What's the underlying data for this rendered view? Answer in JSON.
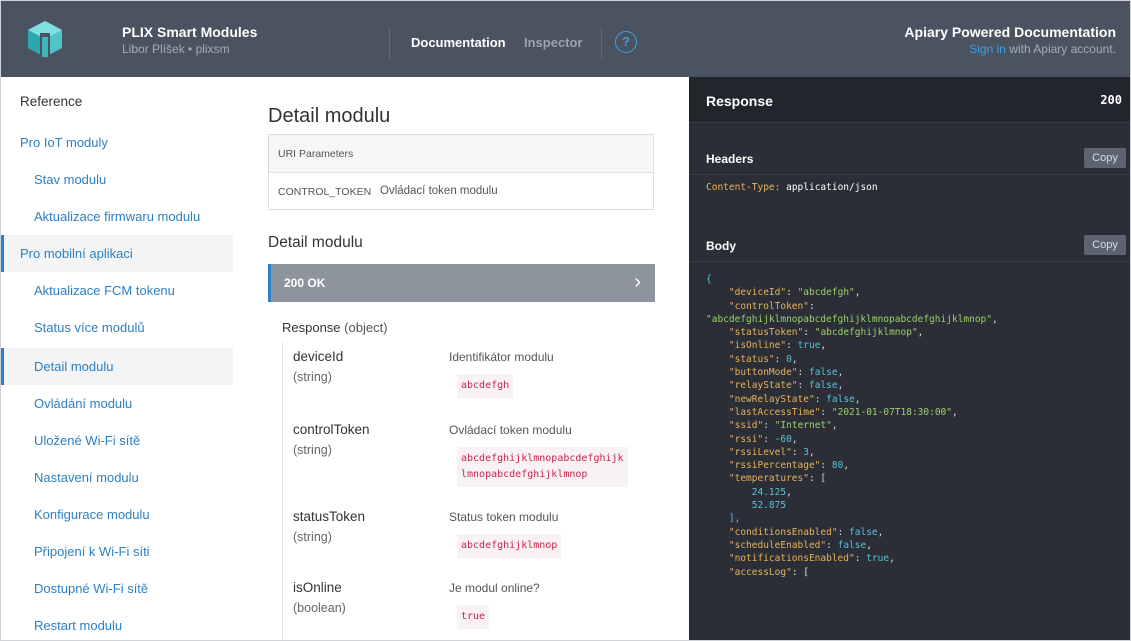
{
  "header": {
    "app_title": "PLIX Smart Modules",
    "app_subtitle": "Libor Plíšek • plixsm",
    "nav": [
      {
        "label": "Documentation"
      },
      {
        "label": "Inspector"
      }
    ],
    "help_glyph": "?",
    "powered_by": "Apiary Powered Documentation",
    "signin_link": "Sign in",
    "signin_rest": " with Apiary account."
  },
  "sidebar": {
    "items": [
      {
        "label": "Reference"
      },
      {
        "label": "Pro IoT moduly"
      },
      {
        "label": "Stav modulu"
      },
      {
        "label": "Aktualizace firmwaru modulu"
      },
      {
        "label": "Pro mobilní aplikaci"
      },
      {
        "label": "Aktualizace FCM tokenu"
      },
      {
        "label": "Status více modulů"
      },
      {
        "label": "Detail modulu"
      },
      {
        "label": "Ovládání modulu"
      },
      {
        "label": "Uložené Wi-Fi sítě"
      },
      {
        "label": "Nastavení modulu"
      },
      {
        "label": "Konfigurace modulu"
      },
      {
        "label": "Připojení k Wi-Fi síti"
      },
      {
        "label": "Dostupné Wi-Fi sítě"
      },
      {
        "label": "Restart modulu"
      }
    ]
  },
  "main": {
    "title": "Detail modulu",
    "uri_params": {
      "heading": "URI Parameters",
      "rows": [
        {
          "name": "CONTROL_TOKEN",
          "desc": "Ovládací token modulu"
        }
      ]
    },
    "action_title": "Detail modulu",
    "status": "200 OK",
    "response_label": "Response",
    "response_type": "(object)",
    "attributes": [
      {
        "name": "deviceId",
        "type": "(string)",
        "desc": "Identifikátor modulu",
        "value": "abcdefgh"
      },
      {
        "name": "controlToken",
        "type": "(string)",
        "desc": "Ovládací token modulu",
        "value_line1": "abcdefghijklmnopabcdefghijk",
        "value_line2": "lmnopabcdefghijklmnop"
      },
      {
        "name": "statusToken",
        "type": "(string)",
        "desc": "Status token modulu",
        "value": "abcdefghijklmnop"
      },
      {
        "name": "isOnline",
        "type": "(boolean)",
        "desc": "Je modul online?",
        "value": "true"
      }
    ]
  },
  "response_panel": {
    "title": "Response",
    "code": "200",
    "headers_title": "Headers",
    "copy_label": "Copy",
    "header_key": "Content-Type:",
    "header_value": "application/json",
    "body_title": "Body",
    "body_lines": [
      "{",
      "    \"deviceId\": \"abcdefgh\",",
      "    \"controlToken\":",
      "\"abcdefghijklmnopabcdefghijklmnopabcdefghijklmnop\",",
      "    \"statusToken\": \"abcdefghijklmnop\",",
      "    \"isOnline\": true,",
      "    \"status\": 0,",
      "    \"buttonMode\": false,",
      "    \"relayState\": false,",
      "    \"newRelayState\": false,",
      "    \"lastAccessTime\": \"2021-01-07T18:30:00\",",
      "    \"ssid\": \"Internet\",",
      "    \"rssi\": -60,",
      "    \"rssiLevel\": 3,",
      "    \"rssiPercentage\": 80,",
      "    \"temperatures\": [",
      "        24.125,",
      "        52.875",
      "    ],",
      "    \"conditionsEnabled\": false,",
      "    \"scheduleEnabled\": false,",
      "    \"notificationsEnabled\": true,",
      "    \"accessLog\": ["
    ]
  },
  "colors": {
    "header_bg": "#4b5360",
    "accent": "#2d7fc4",
    "status_bar": "#8d949e",
    "panel_bg": "#2b2e36",
    "json_key": "#e6b35a",
    "json_string": "#9bd16b",
    "json_literal": "#56c4d9"
  }
}
